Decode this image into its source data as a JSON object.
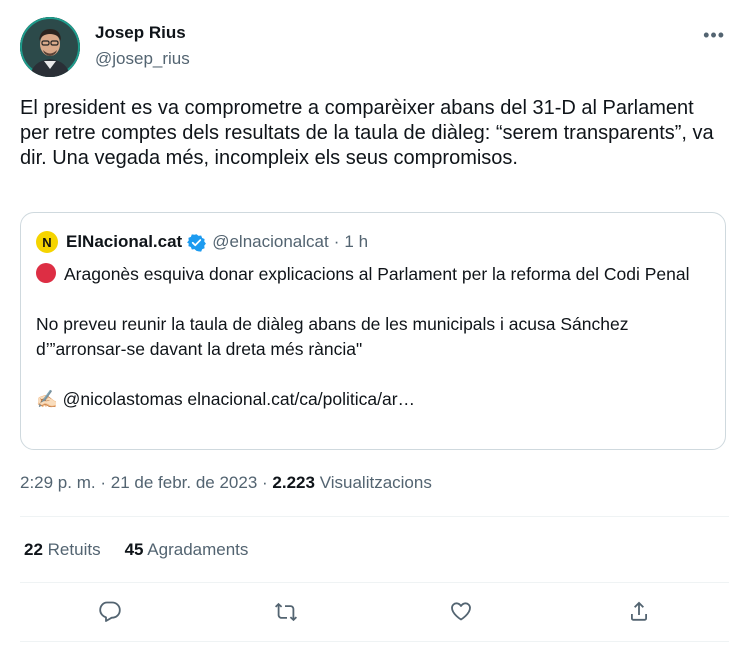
{
  "author": {
    "name": "Josep Rius",
    "handle": "@josep_rius"
  },
  "menu": {
    "more_label": "•••"
  },
  "tweet": {
    "text": "El president es va comprometre a comparèixer abans del 31-D al Parlament per retre comptes dels resultats de la taula de diàleg: “serem transparents”, va dir. Una vegada més, incompleix els seus compromisos."
  },
  "quote": {
    "logo_letter": "N",
    "name": "ElNacional.cat",
    "handle": "@elnacionalcat",
    "separator": "·",
    "time": "1 h",
    "line1": "Aragonès esquiva donar explicacions al Parlament per la reforma del Codi Penal",
    "line2": "No preveu reunir la taula de diàleg abans de les municipals i acusa Sánchez d’”arronsar-se davant la dreta més rància\"",
    "line3_emoji": "✍🏻",
    "line3": "@nicolastomas elnacional.cat/ca/politica/ar…"
  },
  "meta": {
    "time": "2:29 p. m.",
    "dot1": "·",
    "date": "21 de febr. de 2023",
    "dot2": "·",
    "views_count": "2.223",
    "views_label": "Visualitzacions"
  },
  "stats": {
    "retweets_count": "22",
    "retweets_label": "Retuits",
    "likes_count": "45",
    "likes_label": "Agradaments"
  },
  "icons": {
    "reply": "reply-icon",
    "retweet": "retweet-icon",
    "like": "heart-icon",
    "share": "share-icon"
  },
  "colors": {
    "text": "#0f1419",
    "secondary": "#536471",
    "border": "#cfd9de",
    "verified": "#1d9bf0",
    "red_circle": "#dd2e44",
    "logo_bg": "#f5d400"
  }
}
